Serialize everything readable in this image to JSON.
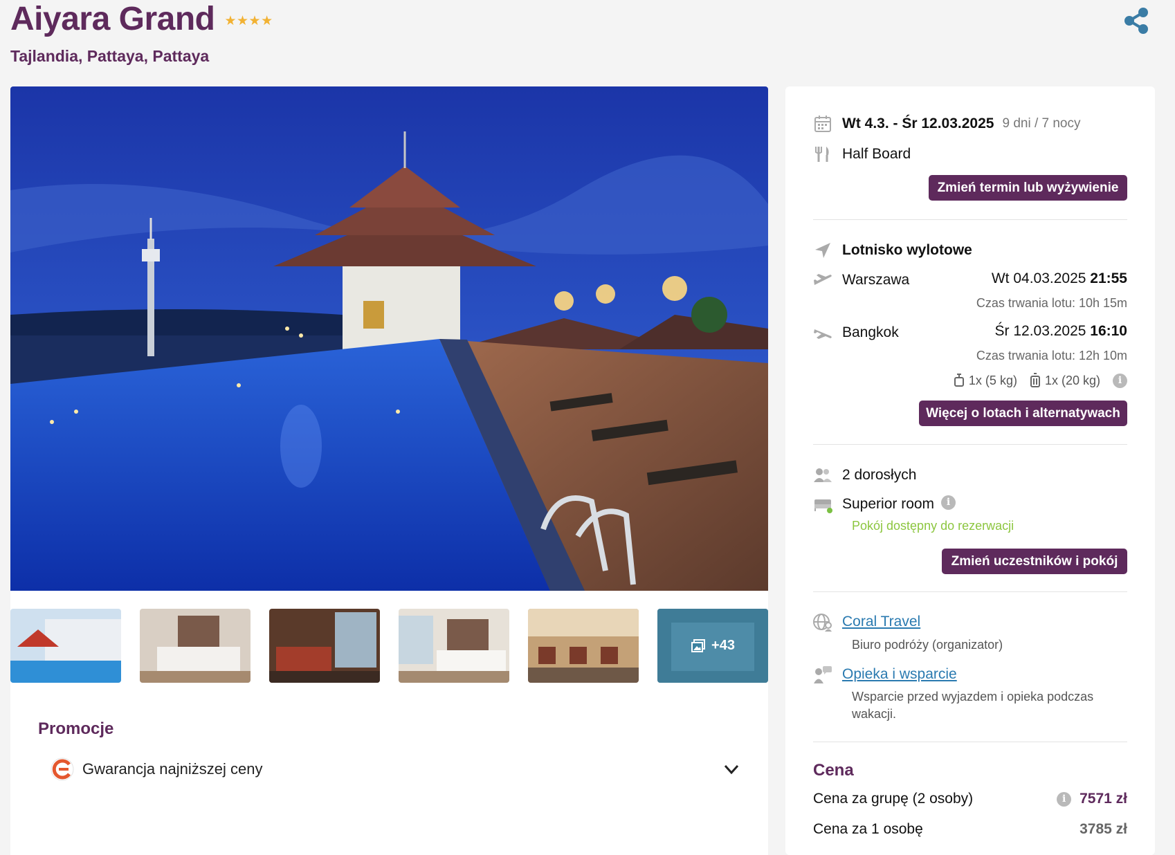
{
  "header": {
    "hotel_name": "Aiyara Grand",
    "stars": 4,
    "location": "Tajlandia, Pattaya, Pattaya",
    "share_icon": "share-icon"
  },
  "gallery": {
    "more_count": "+43"
  },
  "promotions": {
    "title": "Promocje",
    "items": [
      {
        "label": "Gwarancja najniższej ceny"
      }
    ]
  },
  "booking": {
    "dates": "Wt 4.3. - Śr 12.03.2025",
    "duration": "9 dni / 7 nocy",
    "board": "Half Board",
    "change_dates_button": "Zmień termin lub wyżywienie",
    "departure_airport_label": "Lotnisko wylotowe",
    "outbound": {
      "city": "Warszawa",
      "date": "Wt 04.03.2025",
      "time": "21:55",
      "duration": "Czas trwania lotu: 10h 15m"
    },
    "return": {
      "city": "Bangkok",
      "date": "Śr 12.03.2025",
      "time": "16:10",
      "duration": "Czas trwania lotu: 12h 10m"
    },
    "luggage_hand": "1x (5 kg)",
    "luggage_checked": "1x (20 kg)",
    "flights_button": "Więcej o lotach i alternatywach",
    "travelers": "2 dorosłych",
    "room": "Superior room",
    "room_status": "Pokój dostępny do rezerwacji",
    "change_room_button": "Zmień uczestników i pokój",
    "organizer_name": "Coral Travel",
    "organizer_desc": "Biuro podróży (organizator)",
    "support_link": "Opieka i wsparcie",
    "support_desc": "Wsparcie przed wyjazdem i opieka podczas wakacji."
  },
  "price": {
    "title": "Cena",
    "group_label": "Cena za grupę (2 osoby)",
    "group_value": "7571 zł",
    "person_label": "Cena za 1 osobę",
    "person_value": "3785 zł"
  },
  "colors": {
    "brand": "#5e2a5c",
    "star": "#f2b233",
    "available": "#8cc63f",
    "link": "#2a7ab0"
  }
}
